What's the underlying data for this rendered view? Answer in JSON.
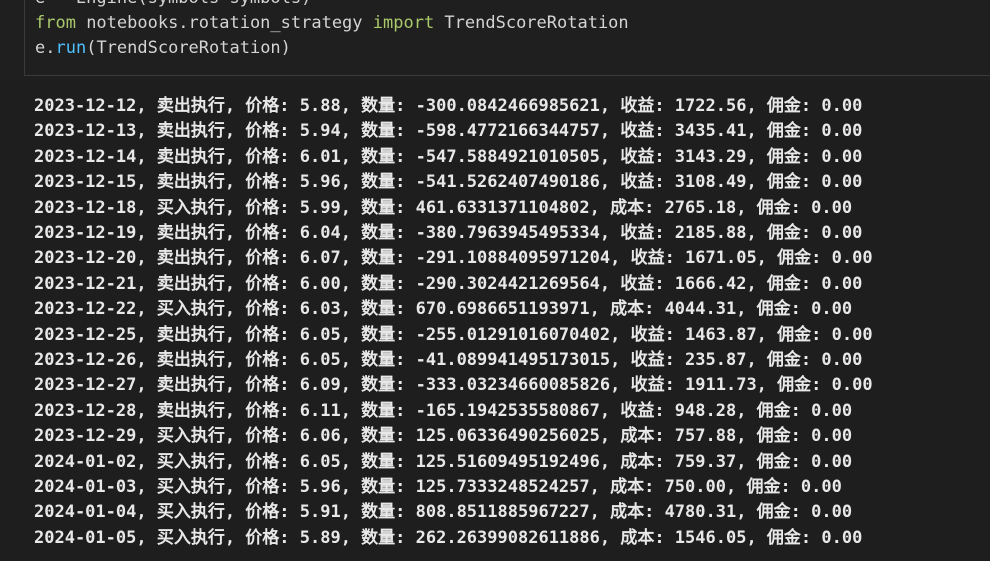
{
  "code_cell": {
    "lines": [
      {
        "parts": [
          {
            "t": "e = Engine(symbols=symbols)",
            "c": "plain"
          }
        ]
      },
      {
        "parts": [
          {
            "t": "from",
            "c": "kw-from"
          },
          {
            "t": " notebooks.rotation_strategy ",
            "c": "plain"
          },
          {
            "t": "import",
            "c": "kw-from"
          },
          {
            "t": " TrendScoreRotation",
            "c": "plain"
          }
        ]
      },
      {
        "parts": [
          {
            "t": "e.",
            "c": "plain"
          },
          {
            "t": "run",
            "c": "run-fn"
          },
          {
            "t": "(TrendScoreRotation)",
            "c": "plain"
          }
        ]
      }
    ]
  },
  "output": {
    "rows": [
      "2023-12-12, 卖出执行, 价格: 5.88, 数量: -300.0842466985621, 收益: 1722.56, 佣金: 0.00",
      "2023-12-13, 卖出执行, 价格: 5.94, 数量: -598.4772166344757, 收益: 3435.41, 佣金: 0.00",
      "2023-12-14, 卖出执行, 价格: 6.01, 数量: -547.5884921010505, 收益: 3143.29, 佣金: 0.00",
      "2023-12-15, 卖出执行, 价格: 5.96, 数量: -541.5262407490186, 收益: 3108.49, 佣金: 0.00",
      "2023-12-18, 买入执行, 价格: 5.99, 数量: 461.6331371104802, 成本: 2765.18, 佣金: 0.00",
      "2023-12-19, 卖出执行, 价格: 6.04, 数量: -380.7963945495334, 收益: 2185.88, 佣金: 0.00",
      "2023-12-20, 卖出执行, 价格: 6.07, 数量: -291.10884095971204, 收益: 1671.05, 佣金: 0.00",
      "2023-12-21, 卖出执行, 价格: 6.00, 数量: -290.3024421269564, 收益: 1666.42, 佣金: 0.00",
      "2023-12-22, 买入执行, 价格: 6.03, 数量: 670.6986651193971, 成本: 4044.31, 佣金: 0.00",
      "2023-12-25, 卖出执行, 价格: 6.05, 数量: -255.0129101607040​2, 收益: 1463.87, 佣金: 0.00",
      "2023-12-26, 卖出执行, 价格: 6.05, 数量: -41.089941495173015, 收益: 235.87, 佣金: 0.00",
      "2023-12-27, 卖出执行, 价格: 6.09, 数量: -333.03234660085826, 收益: 1911.73, 佣金: 0.00",
      "2023-12-28, 卖出执行, 价格: 6.11, 数量: -165.1942535580867, 收益: 948.28, 佣金: 0.00",
      "2023-12-29, 买入执行, 价格: 6.06, 数量: 125.06336490256025, 成本: 757.88, 佣金: 0.00",
      "2024-01-02, 买入执行, 价格: 6.05, 数量: 125.51609495192496, 成本: 759.37, 佣金: 0.00",
      "2024-01-03, 买入执行, 价格: 5.96, 数量: 125.7333248524257, 成本: 750.00, 佣金: 0.00",
      "2024-01-04, 买入执行, 价格: 5.91, 数量: 808.8511885967227, 成本: 4780.31, 佣金: 0.00",
      "2024-01-05, 买入执行, 价格: 5.89, 数量: 262.26399082611886, 成本: 1546.05, 佣金: 0.00"
    ]
  }
}
